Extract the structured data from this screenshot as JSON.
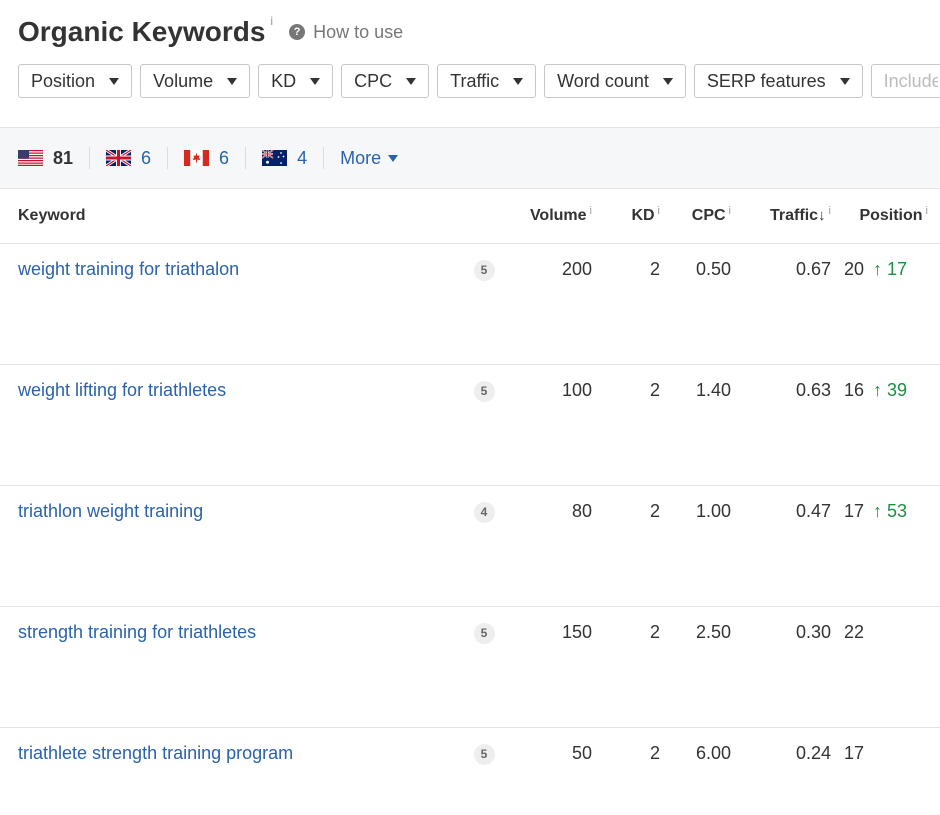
{
  "header": {
    "title": "Organic Keywords",
    "title_info": "i",
    "howto_icon": "question-circle-icon",
    "howto_glyph": "?",
    "howto_label": "How to use"
  },
  "filters": {
    "buttons": [
      "Position",
      "Volume",
      "KD",
      "CPC",
      "Traffic",
      "Word count",
      "SERP features"
    ],
    "include_placeholder": "Include"
  },
  "countries": [
    {
      "code": "us",
      "count": "81",
      "active": true
    },
    {
      "code": "gb",
      "count": "6",
      "active": false
    },
    {
      "code": "ca",
      "count": "6",
      "active": false
    },
    {
      "code": "au",
      "count": "4",
      "active": false
    }
  ],
  "more_label": "More",
  "table": {
    "headers": {
      "keyword": "Keyword",
      "volume": "Volume",
      "kd": "KD",
      "cpc": "CPC",
      "traffic": "Traffic",
      "traffic_sort_glyph": "↓",
      "position": "Position",
      "info": "i"
    },
    "rows": [
      {
        "keyword": "weight training for triathalon",
        "serp": "5",
        "volume": "200",
        "kd": "2",
        "cpc": "0.50",
        "traffic": "0.67",
        "position": "20",
        "change": "↑ 17"
      },
      {
        "keyword": "weight lifting for triathletes",
        "serp": "5",
        "volume": "100",
        "kd": "2",
        "cpc": "1.40",
        "traffic": "0.63",
        "position": "16",
        "change": "↑ 39"
      },
      {
        "keyword": "triathlon weight training",
        "serp": "4",
        "volume": "80",
        "kd": "2",
        "cpc": "1.00",
        "traffic": "0.47",
        "position": "17",
        "change": "↑ 53"
      },
      {
        "keyword": "strength training for triathletes",
        "serp": "5",
        "volume": "150",
        "kd": "2",
        "cpc": "2.50",
        "traffic": "0.30",
        "position": "22",
        "change": ""
      },
      {
        "keyword": "triathlete strength training program",
        "serp": "5",
        "volume": "50",
        "kd": "2",
        "cpc": "6.00",
        "traffic": "0.24",
        "position": "17",
        "change": ""
      }
    ]
  },
  "colors": {
    "link": "#2a62ad",
    "positive": "#1a9141",
    "bar_bg": "#f6f7f9"
  }
}
